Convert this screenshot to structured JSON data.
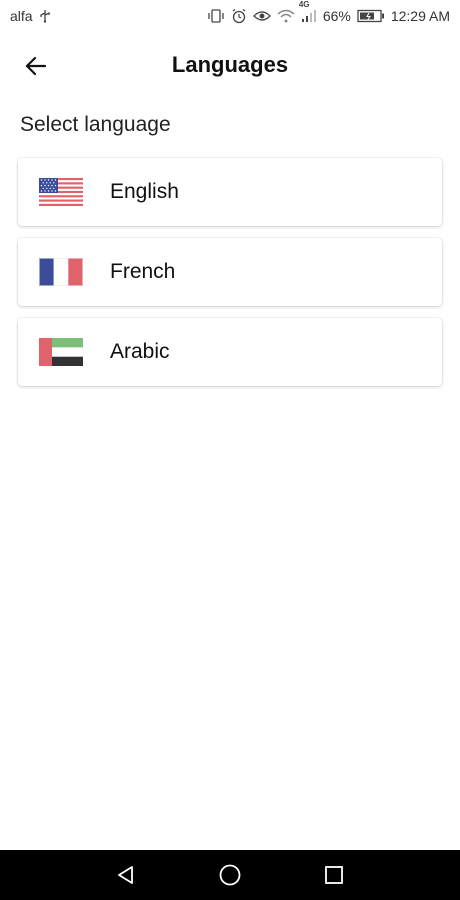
{
  "status_bar": {
    "carrier": "alfa",
    "network_label": "4G",
    "battery_percent": "66%",
    "time": "12:29 AM",
    "icons": [
      "usb-icon",
      "vibrate-icon",
      "alarm-icon",
      "eye-icon",
      "wifi-icon",
      "signal-icon",
      "battery-icon"
    ]
  },
  "header": {
    "title": "Languages",
    "back_icon": "arrow-left-icon"
  },
  "main": {
    "section_label": "Select language",
    "languages": [
      {
        "name": "English",
        "flag": "us-flag-icon"
      },
      {
        "name": "French",
        "flag": "france-flag-icon"
      },
      {
        "name": "Arabic",
        "flag": "uae-flag-icon"
      }
    ]
  },
  "nav_bar": {
    "buttons": [
      "back-triangle-icon",
      "home-circle-icon",
      "recents-square-icon"
    ]
  },
  "colors": {
    "flag_red": "#e0626b",
    "flag_blue": "#3b4c9b",
    "flag_green": "#7dbe7a",
    "flag_black": "#333333",
    "nav_bar": "#000000"
  }
}
